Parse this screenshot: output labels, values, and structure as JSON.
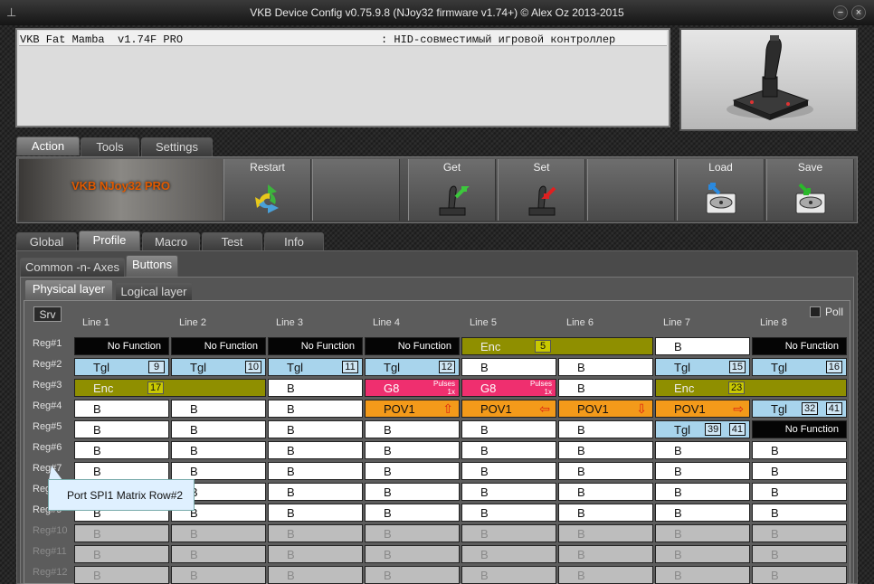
{
  "window": {
    "title": "VKB Device Config v0.75.9.8 (NJoy32 firmware v1.74+) © Alex Oz 2013-2015",
    "app_icon": "joystick-icon",
    "minimize": "−",
    "close": "×"
  },
  "info": {
    "device": "VKB Fat Mamba  v1.74F PRO",
    "description": ": HID-совместимый игровой контроллер"
  },
  "main_tabs": [
    {
      "label": "Action"
    },
    {
      "label": "Tools"
    },
    {
      "label": "Settings"
    }
  ],
  "toolbar": {
    "brand": "VKB NJoy32 PRO",
    "buttons": [
      {
        "label": "Restart",
        "icon": "recycle-icon"
      },
      {
        "label": "",
        "icon": ""
      },
      {
        "label": "Get",
        "icon": "joystick-get-icon"
      },
      {
        "label": "Set",
        "icon": "joystick-set-icon"
      },
      {
        "label": "",
        "icon": ""
      },
      {
        "label": "Load",
        "icon": "disk-load-icon"
      },
      {
        "label": "Save",
        "icon": "disk-save-icon"
      }
    ]
  },
  "profile_tabs": [
    {
      "label": "Global"
    },
    {
      "label": "Profile"
    },
    {
      "label": "Macro"
    },
    {
      "label": "Test"
    },
    {
      "label": "Info"
    }
  ],
  "sub_tabs": [
    {
      "label": "Common -n- Axes"
    },
    {
      "label": "Buttons"
    }
  ],
  "layer_tabs": [
    {
      "label": "Physical layer"
    },
    {
      "label": "Logical layer"
    }
  ],
  "srv_button": "Srv",
  "poll_label": "Poll",
  "lines": [
    "Line 1",
    "Line 2",
    "Line 3",
    "Line 4",
    "Line 5",
    "Line 6",
    "Line 7",
    "Line 8"
  ],
  "regs": [
    "Reg#1",
    "Reg#2",
    "Reg#3",
    "Reg#4",
    "Reg#5",
    "Reg#6",
    "Reg#7",
    "Reg#8",
    "Reg#9",
    "Reg#10",
    "Reg#11",
    "Reg#12"
  ],
  "grid": [
    [
      {
        "t": "nf",
        "label": "No Function"
      },
      {
        "t": "nf",
        "label": "No Function"
      },
      {
        "t": "nf",
        "label": "No Function"
      },
      {
        "t": "nf",
        "label": "No Function"
      },
      {
        "t": "enc",
        "label": "Enc",
        "num": "5",
        "span": 2
      },
      {
        "t": "b",
        "label": "B"
      },
      {
        "t": "nf",
        "label": "No Function"
      }
    ],
    [
      {
        "t": "tgl",
        "label": "Tgl",
        "num": "9"
      },
      {
        "t": "tgl",
        "label": "Tgl",
        "num": "10"
      },
      {
        "t": "tgl",
        "label": "Tgl",
        "num": "11"
      },
      {
        "t": "tgl",
        "label": "Tgl",
        "num": "12"
      },
      {
        "t": "b",
        "label": "B"
      },
      {
        "t": "b",
        "label": "B"
      },
      {
        "t": "tgl",
        "label": "Tgl",
        "num": "15"
      },
      {
        "t": "tgl",
        "label": "Tgl",
        "num": "16"
      }
    ],
    [
      {
        "t": "enc",
        "label": "Enc",
        "num": "17",
        "span": 2
      },
      {
        "t": "b",
        "label": "B"
      },
      {
        "t": "g8",
        "label": "G8",
        "p1": "Pulses",
        "p2": "1x"
      },
      {
        "t": "g8",
        "label": "G8",
        "p1": "Pulses",
        "p2": "1x"
      },
      {
        "t": "b",
        "label": "B"
      },
      {
        "t": "enc",
        "label": "Enc",
        "num": "23",
        "span": 2
      }
    ],
    [
      {
        "t": "b",
        "label": "B"
      },
      {
        "t": "b",
        "label": "B"
      },
      {
        "t": "b",
        "label": "B"
      },
      {
        "t": "pov",
        "label": "POV1",
        "arrow": "⇧"
      },
      {
        "t": "pov",
        "label": "POV1",
        "arrow": "⇦"
      },
      {
        "t": "pov",
        "label": "POV1",
        "arrow": "⇩"
      },
      {
        "t": "pov",
        "label": "POV1",
        "arrow": "⇨"
      },
      {
        "t": "tgl",
        "label": "Tgl",
        "num": "32",
        "num2": "41"
      }
    ],
    [
      {
        "t": "b",
        "label": "B"
      },
      {
        "t": "b",
        "label": "B"
      },
      {
        "t": "b",
        "label": "B"
      },
      {
        "t": "b",
        "label": "B"
      },
      {
        "t": "b",
        "label": "B"
      },
      {
        "t": "b",
        "label": "B"
      },
      {
        "t": "tgl",
        "label": "Tgl",
        "num": "39",
        "num2": "41"
      },
      {
        "t": "nf",
        "label": "No Function"
      }
    ],
    [
      {
        "t": "b",
        "label": "B"
      },
      {
        "t": "b",
        "label": "B"
      },
      {
        "t": "b",
        "label": "B"
      },
      {
        "t": "b",
        "label": "B"
      },
      {
        "t": "b",
        "label": "B"
      },
      {
        "t": "b",
        "label": "B"
      },
      {
        "t": "b",
        "label": "B"
      },
      {
        "t": "b",
        "label": "B"
      }
    ],
    [
      {
        "t": "b",
        "label": "B"
      },
      {
        "t": "b",
        "label": "B"
      },
      {
        "t": "b",
        "label": "B"
      },
      {
        "t": "b",
        "label": "B"
      },
      {
        "t": "b",
        "label": "B"
      },
      {
        "t": "b",
        "label": "B"
      },
      {
        "t": "b",
        "label": "B"
      },
      {
        "t": "b",
        "label": "B"
      }
    ],
    [
      {
        "t": "b",
        "label": "B"
      },
      {
        "t": "b",
        "label": "B"
      },
      {
        "t": "b",
        "label": "B"
      },
      {
        "t": "b",
        "label": "B"
      },
      {
        "t": "b",
        "label": "B"
      },
      {
        "t": "b",
        "label": "B"
      },
      {
        "t": "b",
        "label": "B"
      },
      {
        "t": "b",
        "label": "B"
      }
    ],
    [
      {
        "t": "b",
        "label": "B"
      },
      {
        "t": "b",
        "label": "B"
      },
      {
        "t": "b",
        "label": "B"
      },
      {
        "t": "b",
        "label": "B"
      },
      {
        "t": "b",
        "label": "B"
      },
      {
        "t": "b",
        "label": "B"
      },
      {
        "t": "b",
        "label": "B"
      },
      {
        "t": "b",
        "label": "B"
      }
    ],
    [
      {
        "t": "dis",
        "label": "B"
      },
      {
        "t": "dis",
        "label": "B"
      },
      {
        "t": "dis",
        "label": "B"
      },
      {
        "t": "dis",
        "label": "B"
      },
      {
        "t": "dis",
        "label": "B"
      },
      {
        "t": "dis",
        "label": "B"
      },
      {
        "t": "dis",
        "label": "B"
      },
      {
        "t": "dis",
        "label": "B"
      }
    ],
    [
      {
        "t": "dis",
        "label": "B"
      },
      {
        "t": "dis",
        "label": "B"
      },
      {
        "t": "dis",
        "label": "B"
      },
      {
        "t": "dis",
        "label": "B"
      },
      {
        "t": "dis",
        "label": "B"
      },
      {
        "t": "dis",
        "label": "B"
      },
      {
        "t": "dis",
        "label": "B"
      },
      {
        "t": "dis",
        "label": "B"
      }
    ],
    [
      {
        "t": "dis",
        "label": "B"
      },
      {
        "t": "dis",
        "label": "B"
      },
      {
        "t": "dis",
        "label": "B"
      },
      {
        "t": "dis",
        "label": "B"
      },
      {
        "t": "dis",
        "label": "B"
      },
      {
        "t": "dis",
        "label": "B"
      },
      {
        "t": "dis",
        "label": "B"
      },
      {
        "t": "dis",
        "label": "B"
      }
    ]
  ],
  "tooltip": "Port SPI1 Matrix Row#2",
  "colors": {
    "function_button": "#ffffff",
    "no_function": "#050505",
    "toggle": "#a8d4ec",
    "encoder": "#8f8f00",
    "g8": "#ef2f6f",
    "pov": "#f39a1a",
    "disabled": "#bdbdbd",
    "brand_text": "#e05a00"
  }
}
